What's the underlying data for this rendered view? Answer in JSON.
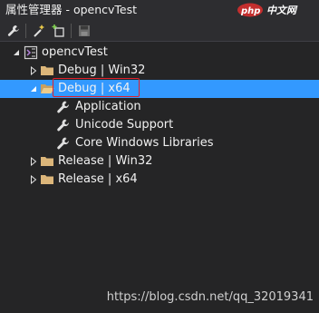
{
  "window": {
    "title": "属性管理器 - opencvTest",
    "watermark": "php 中文网"
  },
  "toolbar": {
    "buttons": [
      "wrench-icon",
      "new-sheet-icon",
      "add-existing-icon",
      "save-icon"
    ]
  },
  "tree": {
    "items": [
      {
        "label": "opencvTest",
        "icon": "project-icon",
        "expanded": true
      },
      {
        "label": "Debug | Win32",
        "icon": "folder-icon",
        "expanded": false
      },
      {
        "label": "Debug | x64",
        "icon": "folder-open-icon",
        "expanded": true,
        "selected": true
      },
      {
        "label": "Application",
        "icon": "wrench-icon"
      },
      {
        "label": "Unicode Support",
        "icon": "wrench-icon"
      },
      {
        "label": "Core Windows Libraries",
        "icon": "wrench-icon"
      },
      {
        "label": "Release | Win32",
        "icon": "folder-icon",
        "expanded": false
      },
      {
        "label": "Release | x64",
        "icon": "folder-icon",
        "expanded": false
      }
    ]
  },
  "footer": {
    "url": "https://blog.csdn.net/qq_32019341"
  },
  "colors": {
    "background": "#252526",
    "selection": "#3399ff",
    "highlight_box": "#e0202a",
    "folder": "#dcb67a"
  }
}
